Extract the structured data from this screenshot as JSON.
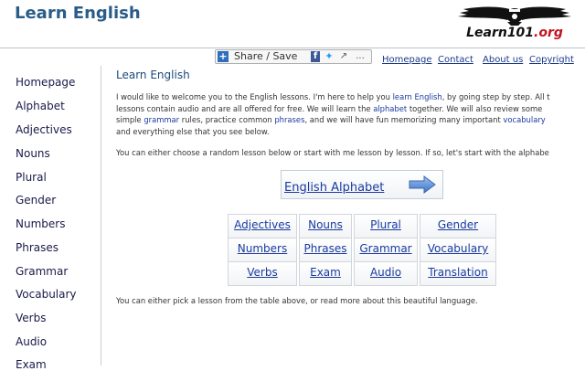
{
  "header": {
    "site_title": "Learn English",
    "logo_text": "Learn101",
    "logo_tld": ".org"
  },
  "share": {
    "label": "Share / Save",
    "more": "..."
  },
  "topnav": {
    "items": [
      "Homepage",
      "Contact",
      "About us",
      "Copyright"
    ]
  },
  "sidebar": {
    "items": [
      "Homepage",
      "Alphabet",
      "Adjectives",
      "Nouns",
      "Plural",
      "Gender",
      "Numbers",
      "Phrases",
      "Grammar",
      "Vocabulary",
      "Verbs",
      "Audio",
      "Exam"
    ]
  },
  "main": {
    "title": "Learn English",
    "intro": {
      "l1a": "I would like to welcome you to the English lessons. I'm here to help you ",
      "l1_link": "learn English",
      "l1b": ", by going step by step. All t",
      "l2a": "lessons contain audio and are all offered for free. We will learn the ",
      "l2_link": "alphabet",
      "l2b": " together. We will also review some",
      "l3a": "simple ",
      "l3_link1": "grammar",
      "l3b": " rules, practice common ",
      "l3_link2": "phrases",
      "l3c": ", and we will have fun memorizing many important ",
      "l3_link3": "vocabulary",
      "l4": "and everything else that you see below."
    },
    "choose_text": "You can either choose a random lesson below or start with me lesson by lesson. If so, let's start with the alphabe",
    "alphabet_button": "English Alphabet",
    "lessons": [
      [
        "Adjectives",
        "Nouns",
        "Plural",
        "Gender"
      ],
      [
        "Numbers",
        "Phrases",
        "Grammar",
        "Vocabulary"
      ],
      [
        "Verbs",
        "Exam",
        "Audio",
        "Translation"
      ]
    ],
    "footer_text": "You can either pick a lesson from the table above, or read more about this beautiful language."
  },
  "colors": {
    "title": "#2a5c8a",
    "link": "#1a3aa0",
    "arrow": "#5b8fd6"
  }
}
